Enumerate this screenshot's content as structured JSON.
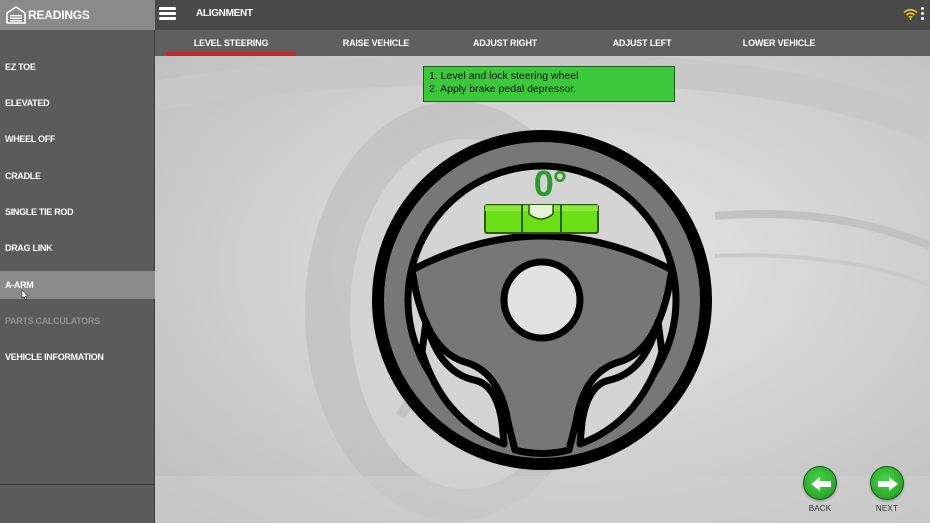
{
  "sidebar": {
    "title": "READINGS",
    "items": [
      {
        "label": "EZ TOE",
        "state": "normal"
      },
      {
        "label": "ELEVATED",
        "state": "normal"
      },
      {
        "label": "WHEEL OFF",
        "state": "normal"
      },
      {
        "label": "CRADLE",
        "state": "normal"
      },
      {
        "label": "SINGLE TIE ROD",
        "state": "normal"
      },
      {
        "label": "DRAG LINK",
        "state": "normal"
      },
      {
        "label": "A-ARM",
        "state": "selected"
      },
      {
        "label": "PARTS CALCULATORS",
        "state": "disabled"
      },
      {
        "label": "VEHICLE INFORMATION",
        "state": "normal"
      }
    ]
  },
  "header": {
    "title": "ALIGNMENT",
    "icons": [
      "menu-icon",
      "wifi-icon",
      "kebab-menu-icon"
    ]
  },
  "tabs": [
    {
      "label": "LEVEL STEERING",
      "active": true
    },
    {
      "label": "RAISE VEHICLE",
      "active": false
    },
    {
      "label": "ADJUST RIGHT",
      "active": false
    },
    {
      "label": "ADJUST LEFT",
      "active": false
    },
    {
      "label": "LOWER VEHICLE",
      "active": false
    }
  ],
  "instructions": {
    "line1": "1. Level and lock steering wheel",
    "line2": "2. Apply brake pedal depressor."
  },
  "steering": {
    "angle_display": "0°"
  },
  "navigation": {
    "back_label": "BACK",
    "next_label": "NEXT"
  },
  "colors": {
    "accent_underline": "#c0262c",
    "instruction_bg": "#3bc83b",
    "level_green": "#6be016",
    "nav_button_green": "#2fae2f",
    "angle_text": "#2e9b2e"
  }
}
